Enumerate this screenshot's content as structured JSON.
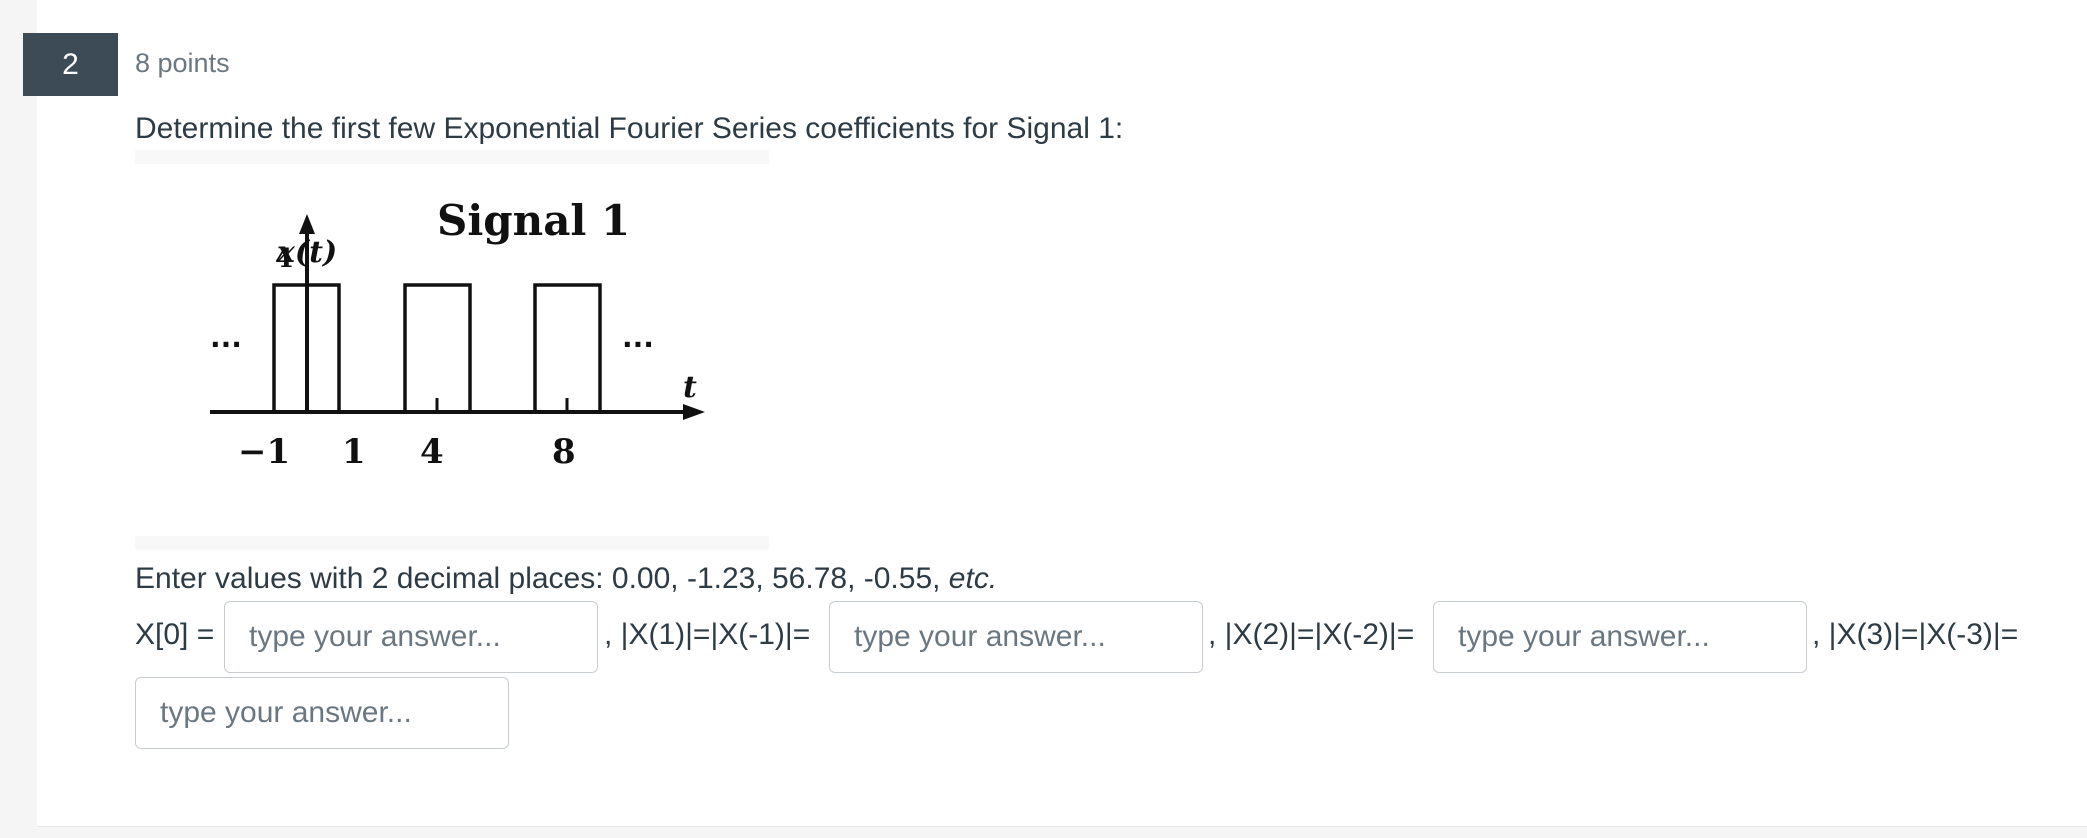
{
  "question": {
    "number": "2",
    "points": "8 points",
    "prompt": "Determine the first few Exponential Fourier Series coefficients for Signal 1:"
  },
  "figure": {
    "y_label": "x(t)",
    "title": "Signal 1",
    "amplitude_label": "4",
    "t_label": "t",
    "ellipsis": "...",
    "ticks": [
      "−1",
      "1",
      "4",
      "8"
    ]
  },
  "instructions": {
    "main": "Enter values with 2 decimal places:  0.00,  -1.23,  56.78, -0.55, ",
    "etc": "etc."
  },
  "answers": {
    "label_x0": "X[0] =",
    "label_x1": ", |X(1)|=|X(-1)|=",
    "label_x2": ", |X(2)|=|X(-2)|=",
    "label_x3": ", |X(3)|=|X(-3)|=",
    "placeholder": "type your answer...",
    "value_x0": "",
    "value_x1": "",
    "value_x2": "",
    "value_x3": ""
  }
}
